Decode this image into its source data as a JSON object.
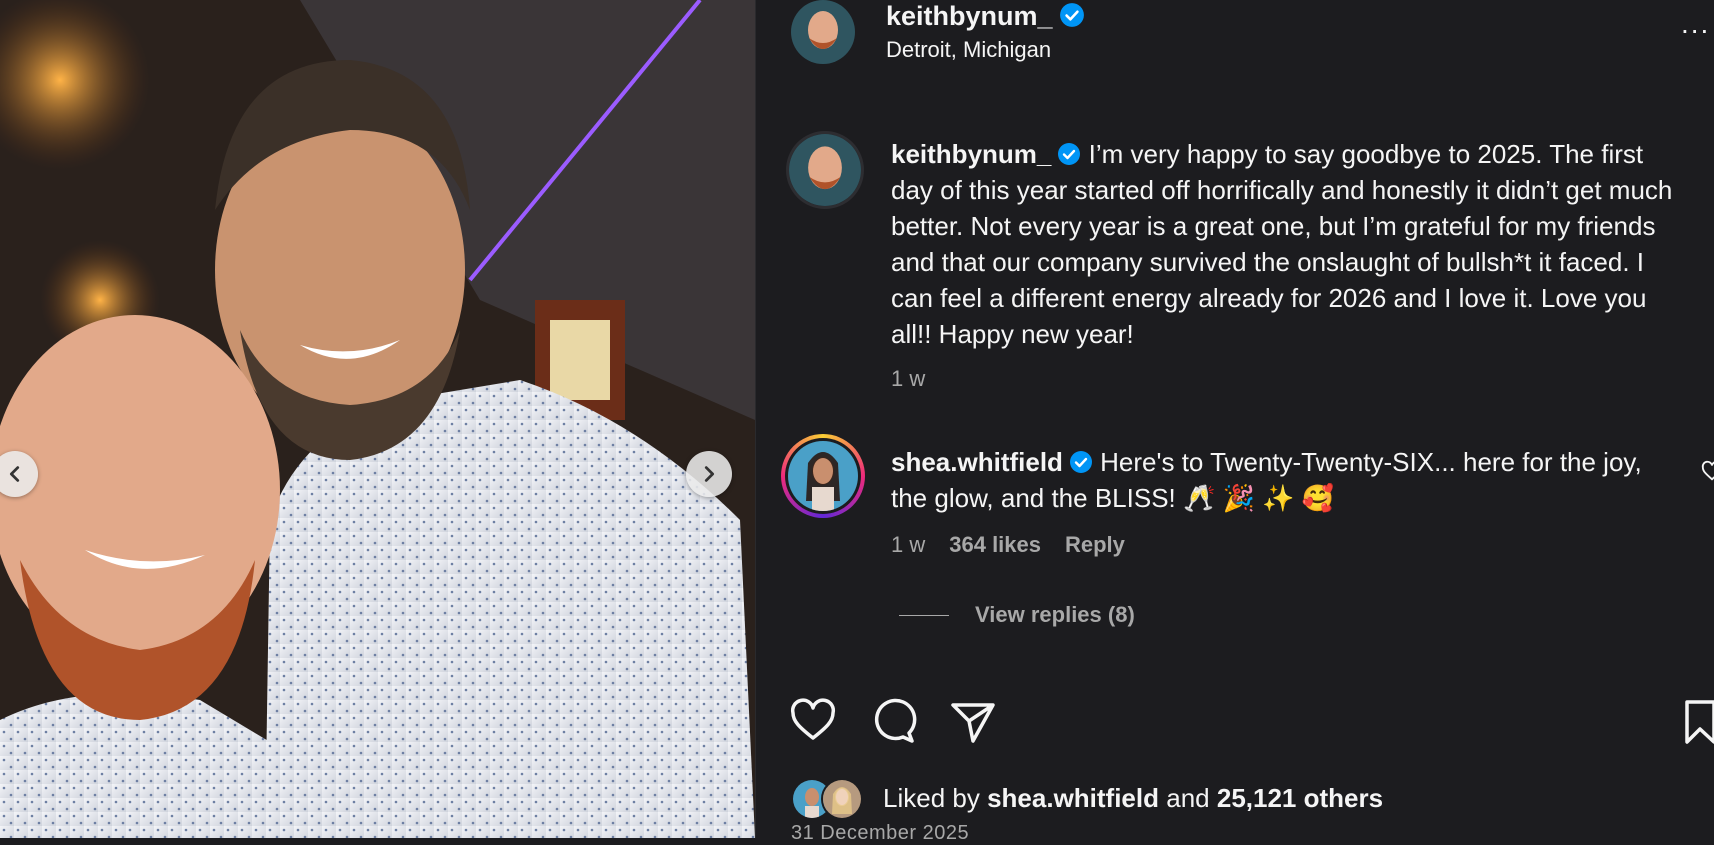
{
  "post": {
    "author": {
      "username": "keithbynum_",
      "location": "Detroit, Michigan",
      "verified_icon": "verified-badge-icon"
    },
    "caption": {
      "username": "keithbynum_",
      "text": "I’m very happy to say goodbye to 2025. The first day of this year started off horrifically and honestly it didn’t get much better. Not every year is a great one, but I’m grateful for my friends and that our company survived the onslaught of bullsh*t it faced. I can feel a different energy already for 2026 and I love it. Love you all!! Happy new year!",
      "time": "1 w"
    },
    "comment": {
      "username": "shea.whitfield",
      "text": "Here's to Twenty-Twenty-SIX... here for the joy, the glow, and the BLISS! 🥂 🎉 ✨ 🥰",
      "time": "1 w",
      "likes": "364 likes",
      "reply_label": "Reply",
      "view_replies": "View replies (8)"
    },
    "likes": {
      "prefix": "Liked by ",
      "first_user": "shea.whitfield",
      "middle": " and ",
      "others": "25,121 others"
    },
    "date": "31 December 2025",
    "more_label": "...",
    "actions": [
      "heart-icon",
      "comment-icon",
      "share-icon",
      "bookmark-icon"
    ]
  },
  "colors": {
    "background": "#1c1c1f",
    "text": "#f5f5f5",
    "secondary_text": "#a8a8a8",
    "verified_blue": "#0095f6"
  }
}
